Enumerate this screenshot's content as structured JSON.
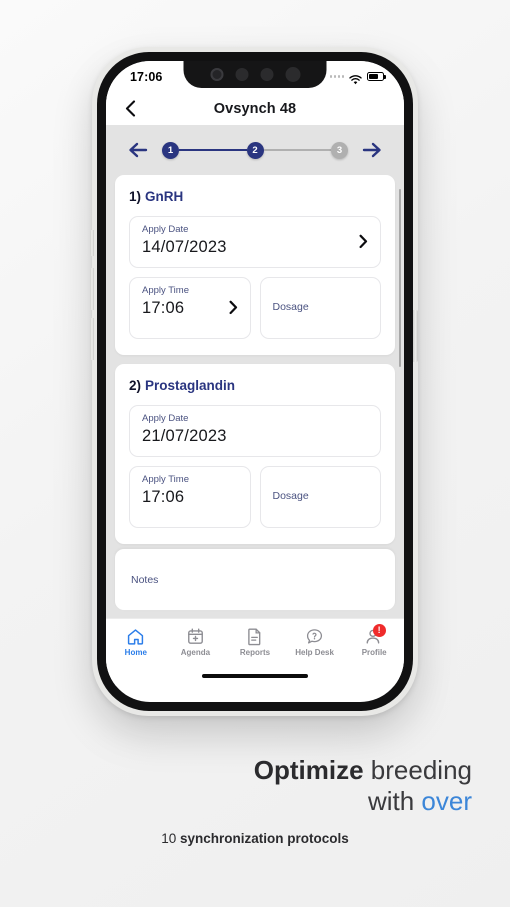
{
  "status_bar": {
    "time": "17:06",
    "icons": [
      "signal-dots-icon",
      "wifi-icon",
      "battery-icon"
    ]
  },
  "header": {
    "back_icon": "back-chevron-icon",
    "title": "Ovsynch 48"
  },
  "stepper": {
    "prev_icon": "arrow-left-icon",
    "next_icon": "arrow-right-icon",
    "steps": [
      {
        "label": "1",
        "state": "active"
      },
      {
        "label": "2",
        "state": "active"
      },
      {
        "label": "3",
        "state": "inactive"
      }
    ],
    "active_color": "#2a3580",
    "inactive_color": "#b0b0b0"
  },
  "protocols": [
    {
      "number": "1)",
      "name": "GnRH",
      "apply_date": {
        "label": "Apply Date",
        "value": "14/07/2023",
        "chevron": "chevron-right-icon"
      },
      "apply_time": {
        "label": "Apply Time",
        "value": "17:06",
        "chevron": "chevron-right-icon"
      },
      "dosage": {
        "label": "Dosage",
        "value": ""
      }
    },
    {
      "number": "2)",
      "name": "Prostaglandin",
      "apply_date": {
        "label": "Apply Date",
        "value": "21/07/2023",
        "chevron": ""
      },
      "apply_time": {
        "label": "Apply Time",
        "value": "17:06",
        "chevron": ""
      },
      "dosage": {
        "label": "Dosage",
        "value": ""
      }
    }
  ],
  "notes": {
    "label": "Notes"
  },
  "tabbar": {
    "items": [
      {
        "label": "Home",
        "icon": "home-icon",
        "active": true,
        "badge": ""
      },
      {
        "label": "Agenda",
        "icon": "calendar-plus-icon",
        "active": false,
        "badge": ""
      },
      {
        "label": "Reports",
        "icon": "document-icon",
        "active": false,
        "badge": ""
      },
      {
        "label": "Help Desk",
        "icon": "question-chat-icon",
        "active": false,
        "badge": ""
      },
      {
        "label": "Profile",
        "icon": "person-icon",
        "active": false,
        "badge": "!"
      }
    ],
    "active_color": "#2b7de9",
    "inactive_color": "#8d8d93",
    "badge_color": "#ef2b2b"
  },
  "marketing": {
    "line1_bold": "Optimize",
    "line1_light": "breeding",
    "line2_dark": "with",
    "line2_blue": "over",
    "sub_number": "10",
    "sub_bold": "synchronization protocols",
    "blue": "#3c86d8"
  }
}
